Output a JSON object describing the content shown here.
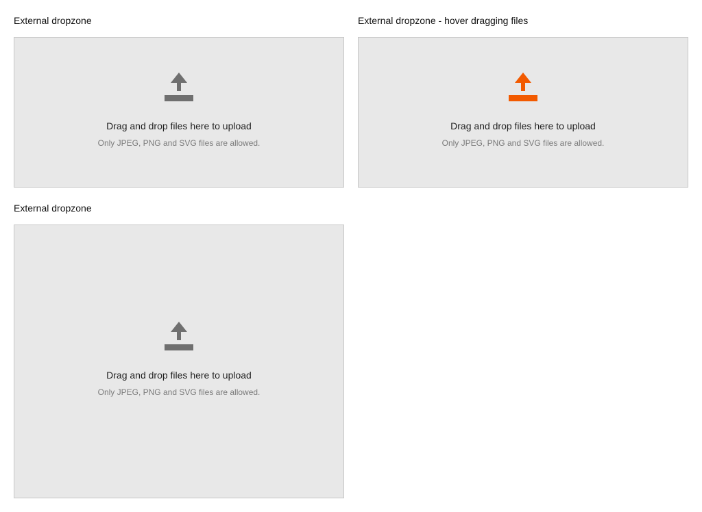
{
  "colors": {
    "icon_default": "#6f6f6f",
    "icon_hover": "#f25a00",
    "dropzone_bg": "#e8e8e8",
    "dropzone_border": "#c6c6c6"
  },
  "dropzones": [
    {
      "title": "External dropzone",
      "icon": "upload-icon",
      "state": "default",
      "main_text": "Drag and drop files here to upload",
      "sub_text": "Only JPEG, PNG and SVG files are allowed."
    },
    {
      "title": "External dropzone - hover dragging files",
      "icon": "upload-icon",
      "state": "hover",
      "main_text": "Drag and drop files here to upload",
      "sub_text": "Only JPEG, PNG and SVG files are allowed."
    },
    {
      "title": "External dropzone",
      "icon": "upload-icon",
      "state": "default",
      "main_text": "Drag and drop files here to upload",
      "sub_text": "Only JPEG, PNG and SVG files are allowed."
    }
  ]
}
